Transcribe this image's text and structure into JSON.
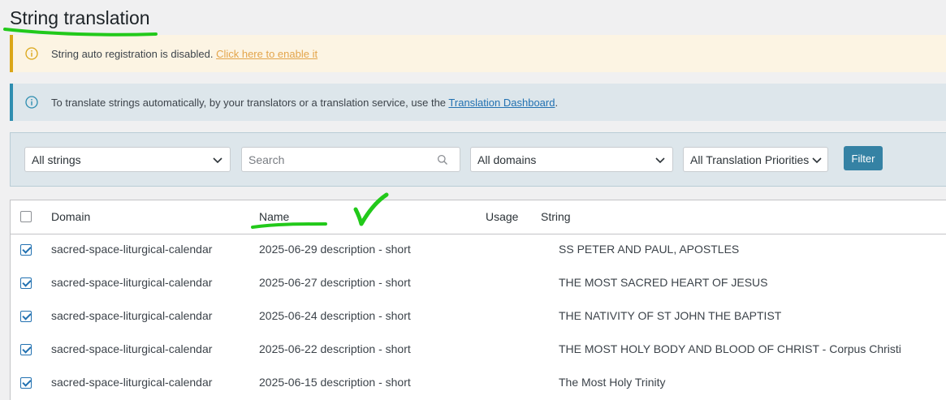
{
  "page": {
    "title": "String translation"
  },
  "notices": {
    "warning": {
      "text": "String auto registration is disabled. ",
      "link": "Click here to enable it"
    },
    "info": {
      "text": "To translate strings automatically, by your translators or a translation service, use the ",
      "link": "Translation Dashboard",
      "suffix": "."
    }
  },
  "filters": {
    "strings_select": "All strings",
    "search_placeholder": "Search",
    "domains_select": "All domains",
    "priorities_select": "All Translation Priorities",
    "filter_button": "Filter"
  },
  "table": {
    "headers": {
      "domain": "Domain",
      "name": "Name",
      "usage": "Usage",
      "string": "String"
    },
    "rows": [
      {
        "checked": true,
        "domain": "sacred-space-liturgical-calendar",
        "name": "2025-06-29 description - short",
        "usage": "",
        "string": "SS PETER AND PAUL, APOSTLES"
      },
      {
        "checked": true,
        "domain": "sacred-space-liturgical-calendar",
        "name": "2025-06-27 description - short",
        "usage": "",
        "string": "THE MOST SACRED HEART OF JESUS"
      },
      {
        "checked": true,
        "domain": "sacred-space-liturgical-calendar",
        "name": "2025-06-24 description - short",
        "usage": "",
        "string": "THE NATIVITY OF ST JOHN THE BAPTIST"
      },
      {
        "checked": true,
        "domain": "sacred-space-liturgical-calendar",
        "name": "2025-06-22 description - short",
        "usage": "",
        "string": "THE MOST HOLY BODY AND BLOOD OF CHRIST - Corpus Christi"
      },
      {
        "checked": true,
        "domain": "sacred-space-liturgical-calendar",
        "name": "2025-06-15 description - short",
        "usage": "",
        "string": "The Most Holy Trinity"
      }
    ]
  },
  "colors": {
    "accent": "#2271b1",
    "filter_button": "#3582a4",
    "warning": "#dba617",
    "annotation": "#22c91a"
  },
  "icons": {
    "notice": "info-icon",
    "search": "search-icon",
    "select": "chevron-down-icon",
    "annotation": "checkmark-icon"
  }
}
